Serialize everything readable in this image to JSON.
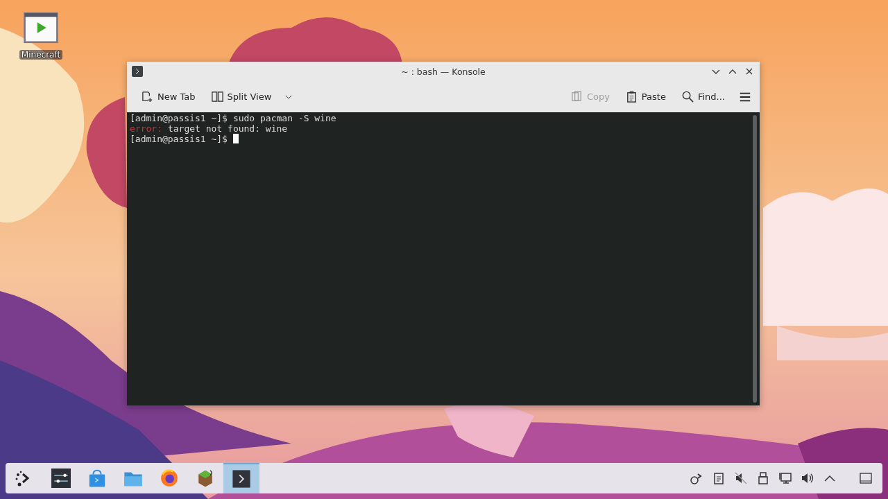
{
  "desktop_icons": [
    {
      "label": "Minecraft"
    }
  ],
  "window": {
    "title": "~ : bash — Konsole",
    "toolbar": [
      {
        "kind": "new-tab",
        "label": "New Tab",
        "disabled": false
      },
      {
        "kind": "split-view",
        "label": "Split View",
        "disabled": false
      },
      {
        "kind": "copy",
        "label": "Copy",
        "disabled": true
      },
      {
        "kind": "paste",
        "label": "Paste",
        "disabled": false
      },
      {
        "kind": "find",
        "label": "Find...",
        "disabled": false
      }
    ],
    "terminal": {
      "lines": [
        {
          "kind": "command",
          "prompt": "[admin@passis1 ~]$",
          "text": "sudo pacman -S wine"
        },
        {
          "kind": "error",
          "label": "error:",
          "text": "target not found: wine"
        },
        {
          "kind": "cursor",
          "prompt": "[admin@passis1 ~]$"
        }
      ]
    }
  },
  "taskbar": {
    "tasks": [
      {
        "kind": "mixer",
        "selected": false
      },
      {
        "kind": "store",
        "selected": false
      },
      {
        "kind": "files",
        "selected": false
      },
      {
        "kind": "browser",
        "selected": false
      },
      {
        "kind": "game",
        "selected": false
      },
      {
        "kind": "terminal",
        "selected": true
      }
    ]
  }
}
